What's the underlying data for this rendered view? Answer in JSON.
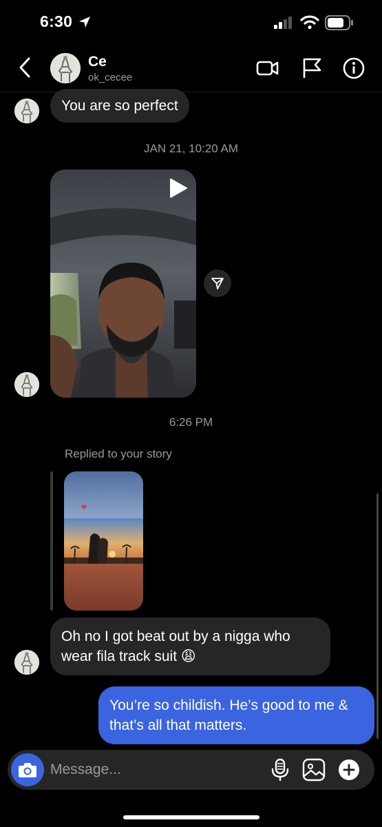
{
  "status_bar": {
    "time": "6:30"
  },
  "header": {
    "name": "Ce",
    "handle": "ok_cecee"
  },
  "messages": {
    "msg1": "You are so perfect",
    "timestamp1": "JAN 21, 10:20 AM",
    "timestamp2": "6:26 PM",
    "reply_label": "Replied to your story",
    "msg2": "Oh no I got beat out by a nigga who wear fila track suit 😩",
    "msg3": "You’re so childish. He’s good to me & that’s all that matters."
  },
  "composer": {
    "placeholder": "Message..."
  },
  "colors": {
    "accent": "#3a64e0",
    "incoming_bubble": "#262626",
    "background": "#000000"
  }
}
